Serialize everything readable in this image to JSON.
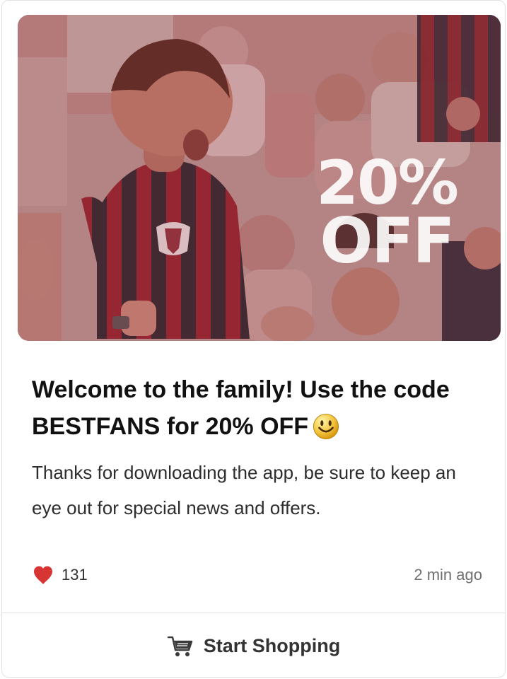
{
  "card": {
    "promo_line_1": "20%",
    "promo_line_2": "OFF",
    "title": "Welcome to the family! Use the code BESTFANS for 20% OFF",
    "body": "Thanks for downloading the app, be sure to keep an eye out for special news and offers.",
    "likes": "131",
    "time": "2 min ago",
    "cta_label": "Start Shopping"
  },
  "icons": {
    "title_emoji": "smiley-face-icon",
    "likes": "heart-icon",
    "cta": "shopping-cart-icon"
  },
  "colors": {
    "heart": "#d73434",
    "accent": "#333333"
  }
}
